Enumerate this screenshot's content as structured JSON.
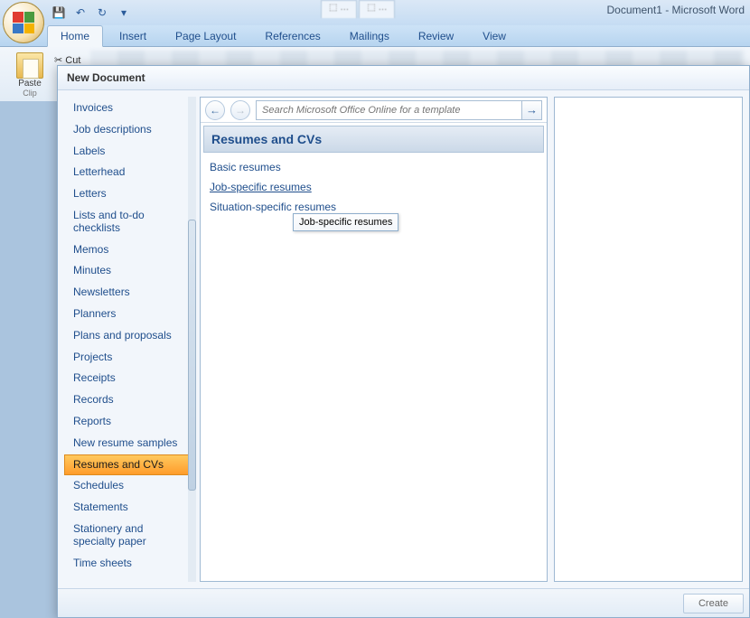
{
  "app": {
    "title": "Document1 - Microsoft Word"
  },
  "qat": {
    "save_icon": "💾",
    "undo_icon": "↶",
    "redo_icon": "↻",
    "menu_icon": "▾"
  },
  "ribbon": {
    "tabs": [
      "Home",
      "Insert",
      "Page Layout",
      "References",
      "Mailings",
      "Review",
      "View"
    ],
    "active": "Home",
    "clipboard": {
      "paste_label": "Paste",
      "cut_label": "Cut",
      "group_label": "Clip"
    }
  },
  "dialog": {
    "title": "New Document",
    "categories": [
      "Invoices",
      "Job descriptions",
      "Labels",
      "Letterhead",
      "Letters",
      "Lists and to-do checklists",
      "Memos",
      "Minutes",
      "Newsletters",
      "Planners",
      "Plans and proposals",
      "Projects",
      "Receipts",
      "Records",
      "Reports",
      "New resume samples",
      "Resumes and CVs",
      "Schedules",
      "Statements",
      "Stationery and specialty paper",
      "Time sheets"
    ],
    "selected_category": "Resumes and CVs",
    "nav": {
      "back_glyph": "←",
      "fwd_glyph": "→",
      "go_glyph": "→"
    },
    "search_placeholder": "Search Microsoft Office Online for a template",
    "section_header": "Resumes and CVs",
    "links": [
      "Basic resumes",
      "Job-specific resumes",
      "Situation-specific resumes"
    ],
    "hovered_link": "Job-specific resumes",
    "tooltip": "Job-specific resumes",
    "create_label": "Create"
  }
}
